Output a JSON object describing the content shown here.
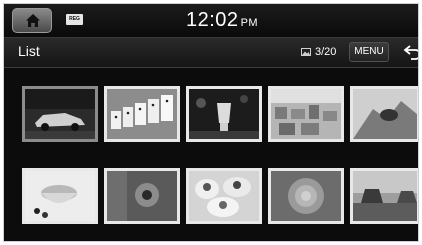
{
  "status_bar": {
    "time": "12:02",
    "ampm": "PM",
    "reg_badge": "REG"
  },
  "title_bar": {
    "title": "List",
    "page_counter": "3/20",
    "menu_label": "MENU"
  },
  "gallery": {
    "selected_index": 0,
    "thumbnails": [
      {
        "subject": "car-in-garage"
      },
      {
        "subject": "dominoes"
      },
      {
        "subject": "cocktail-glass"
      },
      {
        "subject": "city-aerial"
      },
      {
        "subject": "bird"
      },
      {
        "subject": "tea-cup"
      },
      {
        "subject": "flower"
      },
      {
        "subject": "desserts"
      },
      {
        "subject": "succulent"
      },
      {
        "subject": "desert-mesa"
      }
    ]
  }
}
